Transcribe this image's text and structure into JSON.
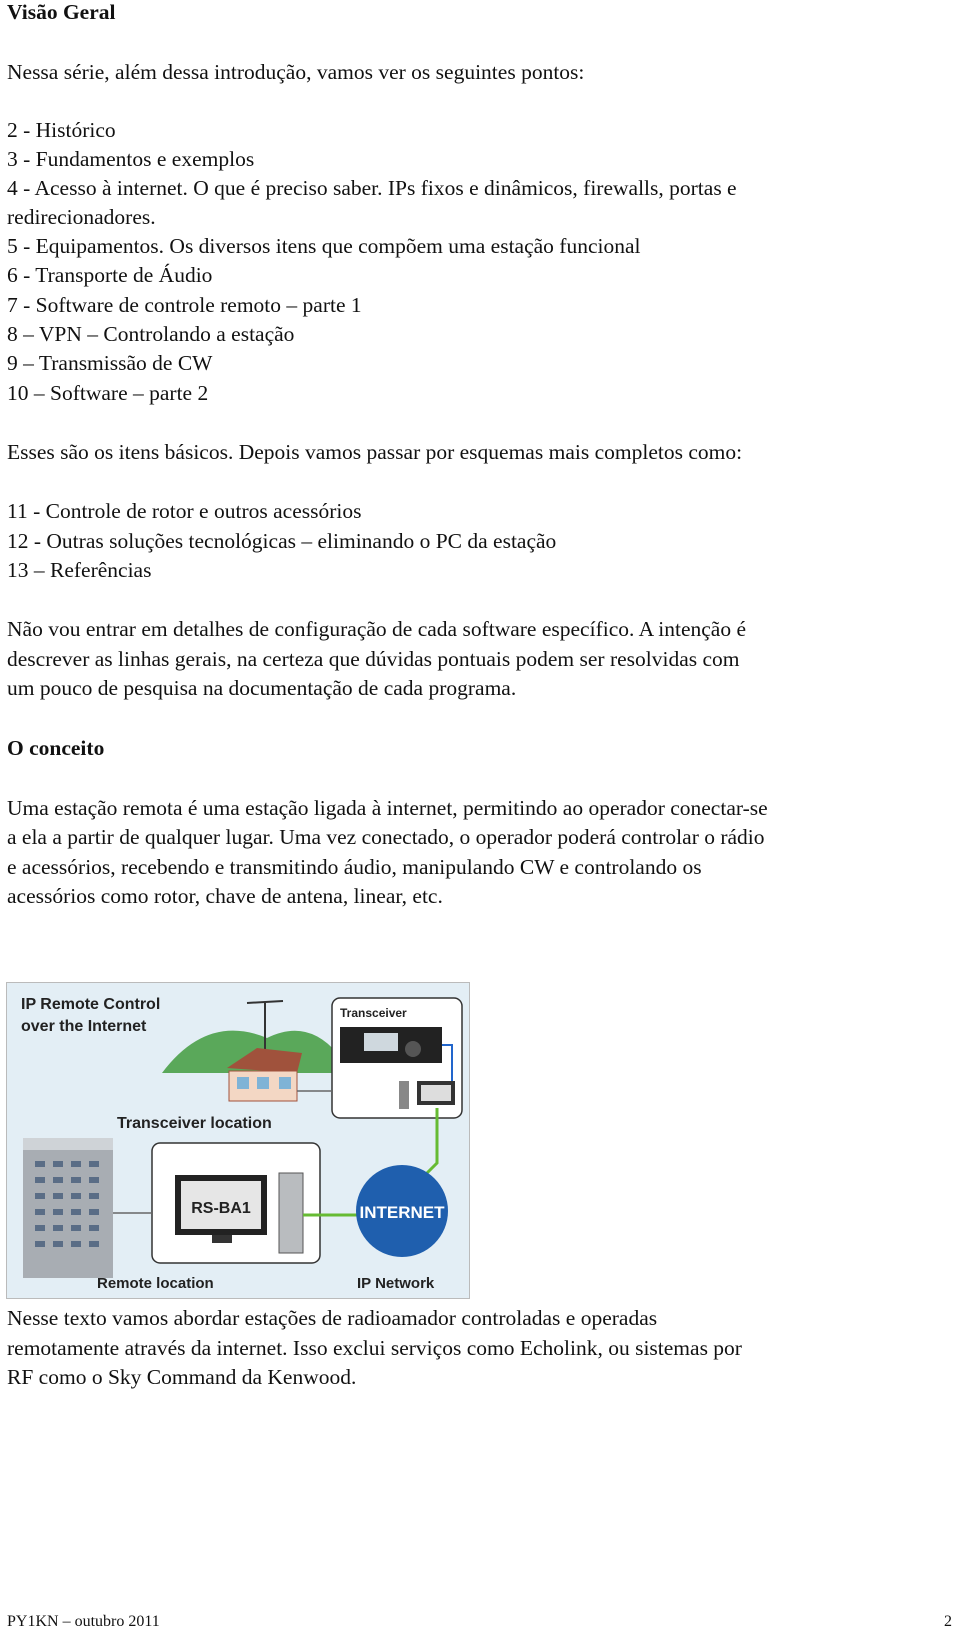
{
  "sections": {
    "overview_heading": "Visão Geral",
    "intro": "Nessa série, além dessa introdução, vamos ver os seguintes pontos:",
    "list1": [
      "2 - Histórico",
      "3 - Fundamentos e exemplos",
      "4 - Acesso à internet. O que é preciso saber. IPs fixos e dinâmicos, firewalls, portas e",
      "redirecionadores.",
      "5 - Equipamentos. Os diversos itens que compõem uma estação funcional",
      "6 - Transporte de Áudio",
      "7 - Software de controle remoto – parte 1",
      "8 – VPN – Controlando a estação",
      "9 – Transmissão de CW",
      "10 – Software – parte 2"
    ],
    "basics": "Esses são os itens básicos. Depois vamos passar por esquemas mais completos como:",
    "list2": [
      "11 - Controle de rotor e outros acessórios",
      "12 - Outras soluções tecnológicas – eliminando o PC da estação",
      "13 – Referências"
    ],
    "para1": [
      "Não vou entrar em detalhes de configuração de cada software específico. A intenção é",
      "descrever as linhas gerais, na certeza que dúvidas pontuais podem ser resolvidas com",
      "um pouco de pesquisa na documentação de cada programa."
    ],
    "concept_heading": "O conceito",
    "para2": [
      "Uma estação remota é uma estação ligada à internet, permitindo ao operador conectar-se",
      "a ela a partir de qualquer lugar. Uma vez conectado, o operador poderá controlar o rádio",
      "e acessórios, recebendo e transmitindo áudio, manipulando CW e controlando os",
      "acessórios como rotor, chave de antena, linear, etc."
    ],
    "para3": [
      "Nesse texto vamos abordar estações de radioamador controladas e operadas",
      "remotamente através da internet. Isso exclui serviços como Echolink, ou sistemas por",
      "RF como o Sky Command da Kenwood."
    ]
  },
  "figure": {
    "title_line1": "IP Remote Control",
    "title_line2": "over the Internet",
    "transceiver_label": "Transceiver",
    "transceiver_location": "Transceiver location",
    "rsba1_label": "RS-BA1",
    "internet_label": "INTERNET",
    "remote_location": "Remote location",
    "ip_network": "IP Network"
  },
  "footer": {
    "left": "PY1KN – outubro 2011",
    "page_number": "2"
  }
}
